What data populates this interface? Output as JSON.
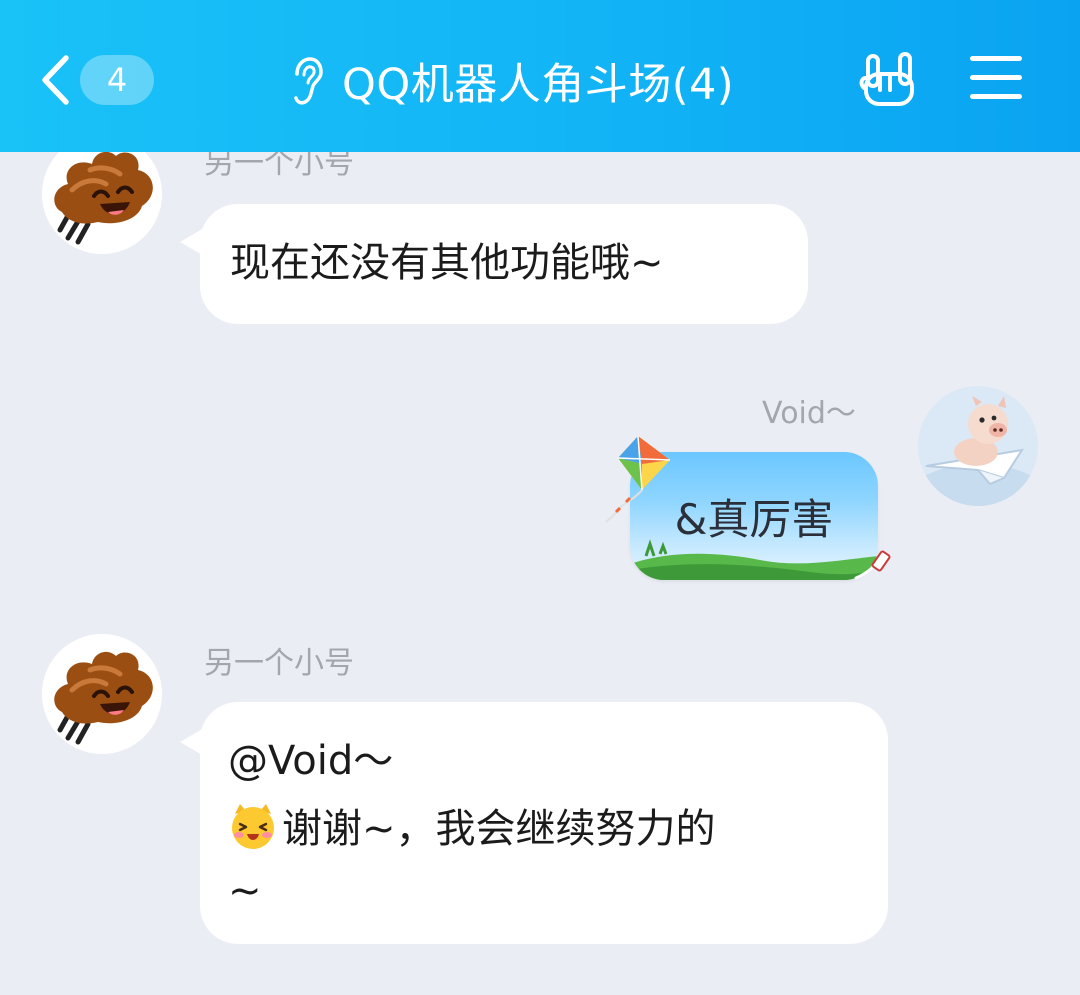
{
  "header": {
    "unread_count": "4",
    "title": "QQ机器人角斗场(4)",
    "icons": [
      "back-chevron-icon",
      "ear-icon",
      "hand-rock-icon",
      "menu-icon"
    ]
  },
  "messages": [
    {
      "sender": "另一个小号",
      "lines": [
        "现在还没有其他功能哦~"
      ],
      "side": "left",
      "avatar_icon": "poop-emoji-avatar"
    },
    {
      "sender": "Void〜",
      "lines": [
        "&真厉害"
      ],
      "side": "right",
      "avatar_icon": "pig-on-paper-plane-avatar",
      "bubble_theme": "kite-sky-bubble"
    },
    {
      "sender": "另一个小号",
      "lines": [
        "@Void〜",
        "谢谢~，我会继续努力的",
        "~"
      ],
      "side": "left",
      "avatar_icon": "poop-emoji-avatar",
      "inline_emoji": "happy-cat-face-emoji"
    }
  ],
  "colors": {
    "header_start": "#19c2f7",
    "header_end": "#0aa3f2",
    "background": "#ebedf5",
    "bubble": "#ffffff",
    "name_text": "#a3a6ad"
  }
}
